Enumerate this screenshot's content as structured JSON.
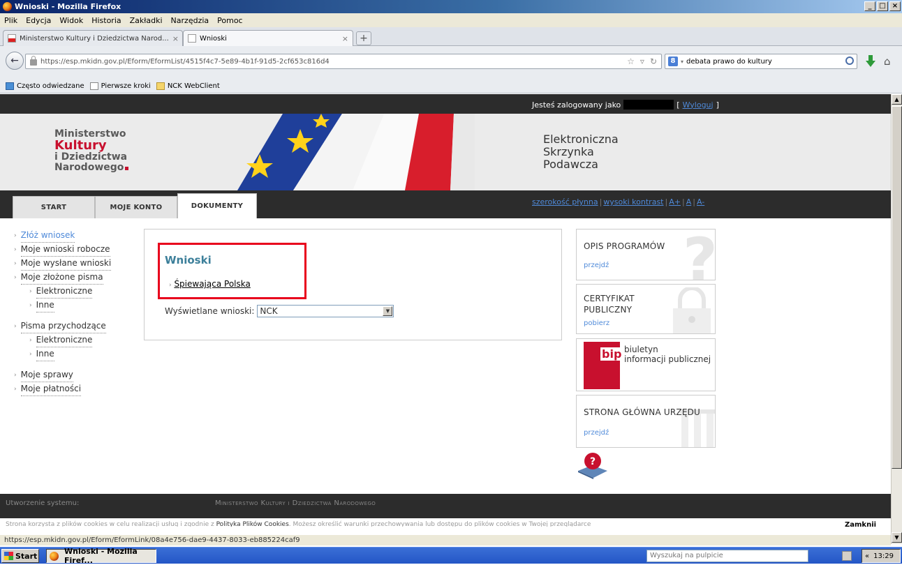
{
  "window": {
    "title": "Wnioski - Mozilla Firefox",
    "controls": [
      "_",
      "□",
      "×"
    ]
  },
  "menu": [
    "Plik",
    "Edycja",
    "Widok",
    "Historia",
    "Zakładki",
    "Narzędzia",
    "Pomoc"
  ],
  "tabs": [
    {
      "label": "Ministerstwo Kultury i Dziedzictwa Narod...",
      "close": "×"
    },
    {
      "label": "Wnioski",
      "close": "×"
    }
  ],
  "new_tab": "+",
  "address": {
    "url": "https://esp.mkidn.gov.pl/Eform/EformList/4515f4c7-5e89-4b1f-91d5-2cf653c816d4",
    "icons": [
      "star-icon",
      "dropdown-icon",
      "reload-icon"
    ]
  },
  "search": {
    "engine": "8",
    "value": "debata prawo do kultury"
  },
  "bookmarks": [
    "Często odwiedzane",
    "Pierwsze kroki",
    "NCK WebClient"
  ],
  "site": {
    "logged_in_label": "Jesteś zalogowany jako",
    "logout": "Wyloguj",
    "logout_open": "[",
    "logout_close": "]",
    "logo": {
      "line1": "Ministerstwo",
      "line2": "Kultury",
      "line3": "i Dziedzictwa",
      "line4": "Narodowego"
    },
    "esp": {
      "line1": "Elektroniczna",
      "line2": "Skrzynka",
      "line3": "Podawcza"
    },
    "nav_tabs": [
      "START",
      "MOJE KONTO",
      "DOKUMENTY"
    ],
    "a11y": [
      "szerokość płynna",
      "wysoki kontrast",
      "A+",
      "A",
      "A-"
    ],
    "left_menu": [
      {
        "label": "Złóż wniosek",
        "level": 0
      },
      {
        "label": "Moje wnioski robocze",
        "level": 0
      },
      {
        "label": "Moje wysłane wnioski",
        "level": 0
      },
      {
        "label": "Moje złożone pisma",
        "level": 0
      },
      {
        "label": "Elektroniczne",
        "level": 1
      },
      {
        "label": "Inne",
        "level": 1
      },
      {
        "label": "Pisma przychodzące",
        "level": 0
      },
      {
        "label": "Elektroniczne",
        "level": 1
      },
      {
        "label": "Inne",
        "level": 1
      },
      {
        "label": "Moje sprawy",
        "level": 0
      },
      {
        "label": "Moje płatności",
        "level": 0
      }
    ],
    "main": {
      "title": "Wnioski",
      "link": "Śpiewająca Polska",
      "filter_label": "Wyświetlane wnioski:",
      "filter_value": "NCK"
    },
    "side_boxes": {
      "opis": {
        "title": "OPIS PROGRAMÓW",
        "action": "przejdź"
      },
      "cert": {
        "title_line1": "CERTYFIKAT",
        "title_line2": "PUBLICZNY",
        "action": "pobierz"
      },
      "bip": {
        "logo": "bip",
        "text_line1": "biuletyn",
        "text_line2": "informacji publicznej"
      },
      "strona": {
        "title": "STRONA GŁÓWNA URZĘDU",
        "action": "przejdź"
      }
    },
    "footer": {
      "created_label": "Utworzenie systemu:",
      "ministry": "Ministerstwo Kultury i Dziedzictwa Narodowego"
    },
    "cookie": {
      "text_before": "Strona korzysta z plików cookies w celu realizacji usług i zgodnie z",
      "policy": "Polityka Plików Cookies",
      "text_after": ". Możesz określić warunki przechowywania lub dostępu do plików cookies w Twojej przeglądarce",
      "close": "Zamknij"
    }
  },
  "status_bar": "https://esp.mkidn.gov.pl/Eform/EformLink/08a4e756-dae9-4437-8033-eb885224caf9",
  "taskbar": {
    "start": "Start",
    "item": "Wnioski - Mozilla Firef...",
    "search_placeholder": "Wyszukaj na pulpicie",
    "clock": "13:29",
    "tray_arrows": "«"
  },
  "colors": {
    "red_highlight": "#e8001c",
    "dark_strip": "#2c2c2c",
    "link": "#4f8ad9",
    "title_teal": "#3c7f9a",
    "brand_red": "#c8102e"
  }
}
